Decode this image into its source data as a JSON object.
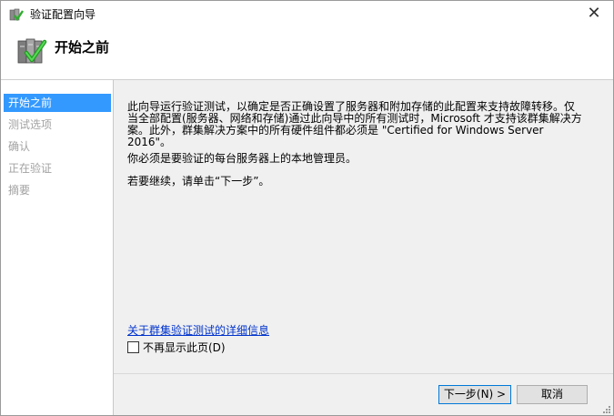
{
  "window": {
    "title": "验证配置向导",
    "close_label": "✕"
  },
  "header": {
    "title": "开始之前"
  },
  "sidebar": {
    "items": [
      {
        "label": "开始之前",
        "active": true
      },
      {
        "label": "测试选项",
        "active": false
      },
      {
        "label": "确认",
        "active": false
      },
      {
        "label": "正在验证",
        "active": false
      },
      {
        "label": "摘要",
        "active": false
      }
    ]
  },
  "main": {
    "paragraph1": "此向导运行验证测试，以确定是否正确设置了服务器和附加存储的此配置来支持故障转移。仅当全部配置(服务器、网络和存储)通过此向导中的所有测试时，Microsoft 才支持该群集解决方案。此外，群集解决方案中的所有硬件组件都必须是 \"Certified for Windows Server 2016\"。",
    "paragraph2": "你必须是要验证的每台服务器上的本地管理员。",
    "paragraph3": "若要继续，请单击“下一步”。",
    "details_link": "关于群集验证测试的详细信息",
    "dont_show_label": "不再显示此页(D)"
  },
  "footer": {
    "next_label": "下一步(N) >",
    "cancel_label": "取消"
  },
  "colors": {
    "selection": "#3399ff",
    "panel_bg": "#f0f0f0",
    "link": "#0033cc",
    "disabled_text": "#a2a2a2",
    "button_focus_border": "#0078d7"
  }
}
